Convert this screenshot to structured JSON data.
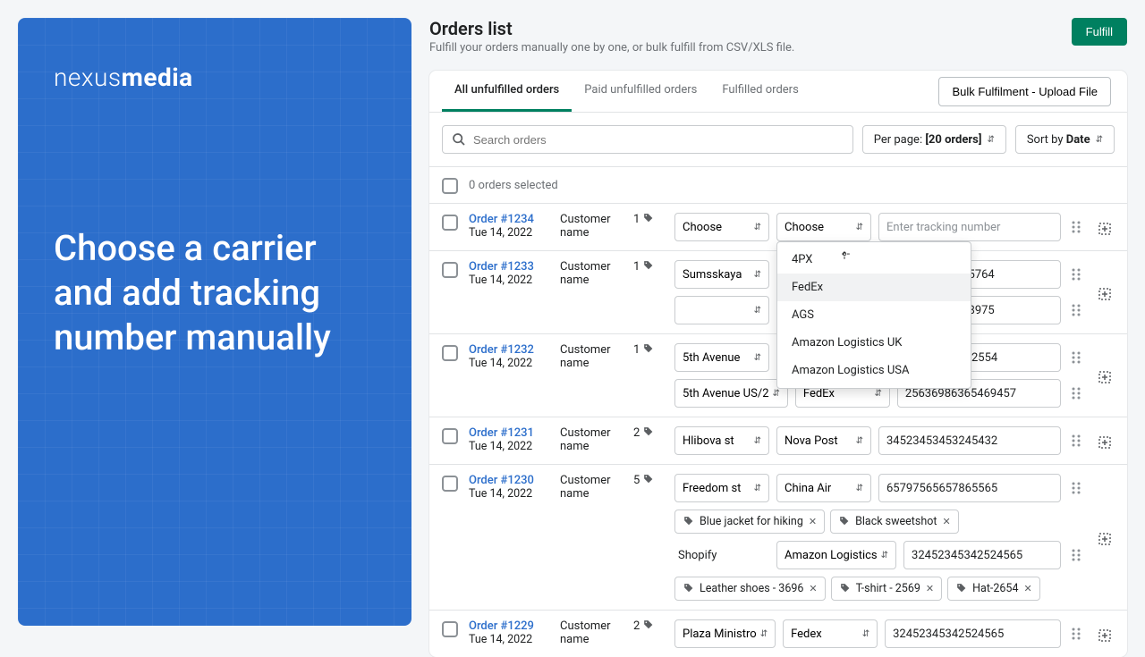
{
  "promo": {
    "logo_light": "nexus",
    "logo_bold": "media",
    "headline": "Choose a carrier and add tracking number manually"
  },
  "header": {
    "title": "Orders list",
    "subtitle": "Fulfill your orders manually one by one, or bulk fulfill from CSV/XLS file.",
    "fulfill_btn": "Fulfill"
  },
  "tabs": {
    "all": "All unfulfilled orders",
    "paid": "Paid unfulfilled orders",
    "fulfilled": "Fulfilled orders",
    "bulk_btn": "Bulk Fulfilment - Upload File"
  },
  "filters": {
    "search_placeholder": "Search orders",
    "per_page_label": "Per page:",
    "per_page_value": "[20 orders]",
    "sort_label": "Sort by",
    "sort_value": "Date"
  },
  "list_header": {
    "selected": "0 orders selected"
  },
  "dropdown": {
    "items": [
      "4PX",
      "FedEx",
      "AGS",
      "Amazon Logistics UK",
      "Amazon Logistics USA"
    ],
    "highlighted": 1
  },
  "fields": {
    "choose": "Choose",
    "tracking_placeholder": "Enter tracking number"
  },
  "orders": [
    {
      "id": "Order #1234",
      "date": "Tue 14, 2022",
      "customer": "Customer name",
      "items": "1",
      "rows": [
        {
          "addr": "Choose",
          "carrier": "Choose",
          "tracking": "",
          "placeholder": true
        }
      ]
    },
    {
      "id": "Order #1233",
      "date": "Tue 14, 2022",
      "customer": "Customer name",
      "items": "1",
      "rows": [
        {
          "addr": "Sumsskaya",
          "carrier": "",
          "tracking": "NVP9008766575764"
        },
        {
          "addr": "",
          "carrier": "",
          "tracking": "NVP9008762568975"
        }
      ]
    },
    {
      "id": "Order #1232",
      "date": "Tue 14, 2022",
      "customer": "Customer name",
      "items": "1",
      "rows": [
        {
          "addr": "5th Avenue",
          "carrier": "",
          "tracking": "32453245324532554"
        },
        {
          "addr": "5th Avenue US/2",
          "carrier": "FedEx",
          "tracking": "25636986365469457"
        }
      ]
    },
    {
      "id": "Order #1231",
      "date": "Tue 14, 2022",
      "customer": "Customer name",
      "items": "2",
      "rows": [
        {
          "addr": "Hlibova st",
          "carrier": "Nova Post",
          "tracking": "34523453453245432"
        }
      ]
    },
    {
      "id": "Order #1230",
      "date": "Tue 14, 2022",
      "customer": "Customer name",
      "items": "5",
      "rows": [
        {
          "addr": "Freedom st",
          "carrier": "China Air",
          "tracking": "65797565657865565"
        }
      ],
      "chips1": [
        "Blue jacket for hiking",
        "Black sweetshot"
      ],
      "rows2": [
        {
          "addr_static": "Shopify",
          "carrier": "Amazon Logistics",
          "tracking": "32452345342524565"
        }
      ],
      "chips2": [
        "Leather shoes - 3696",
        "T-shirt - 2569",
        "Hat-2654"
      ]
    },
    {
      "id": "Order #1229",
      "date": "Tue 14, 2022",
      "customer": "Customer name",
      "items": "2",
      "rows": [
        {
          "addr": "Plaza Ministro",
          "carrier": "Fedex",
          "tracking": "32452345342524565"
        }
      ]
    }
  ]
}
